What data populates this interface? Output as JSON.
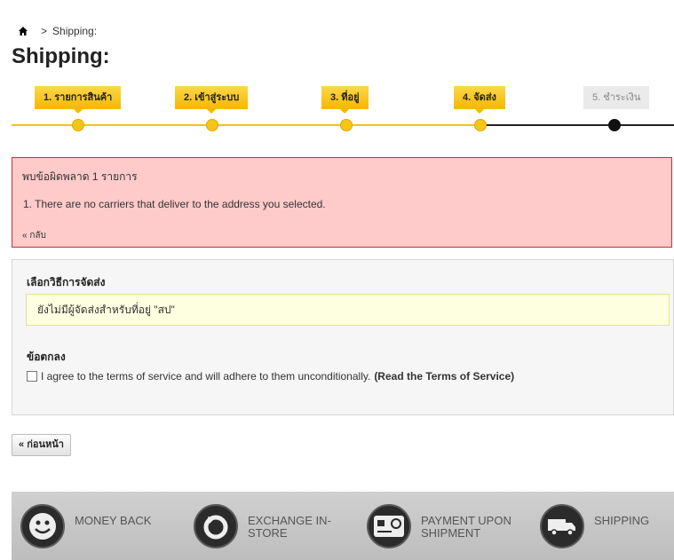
{
  "breadcrumb": {
    "current": "Shipping:",
    "separator": ">"
  },
  "page_title": "Shipping:",
  "steps": [
    {
      "label": "1. รายการสินค้า",
      "state": "done"
    },
    {
      "label": "2. เข้าสู่ระบบ",
      "state": "done"
    },
    {
      "label": "3. ที่อยู่",
      "state": "done"
    },
    {
      "label": "4. จัดส่ง",
      "state": "current"
    },
    {
      "label": "5. ชำระเงิน",
      "state": "todo"
    }
  ],
  "error": {
    "header": "พบข้อผิดพลาด 1 รายการ",
    "message": "1.  There are no carriers that deliver to the address you selected.",
    "back": "« กลับ"
  },
  "carrier": {
    "heading": "เลือกวิธีการจัดส่ง",
    "warning": "ยังไม่มีผู้จัดส่งสำหรับที่อยู่ \"สป\""
  },
  "terms": {
    "heading": "ข้อตกลง",
    "text": "I agree to the terms of service and will adhere to them unconditionally.",
    "link": "(Read the Terms of Service)",
    "checked": false
  },
  "prev_button": "« ก่อนหน้า",
  "footer": [
    {
      "label": "MONEY BACK",
      "icon": "smiley-icon"
    },
    {
      "label": "EXCHANGE IN-STORE",
      "icon": "exchange-icon"
    },
    {
      "label": "PAYMENT UPON SHIPMENT",
      "icon": "credit-card-icon"
    },
    {
      "label": "SHIPPING",
      "icon": "truck-icon"
    }
  ],
  "colors": {
    "accent": "#f5c518",
    "error_bg": "#fecaca",
    "warning_bg": "#fefee0"
  }
}
